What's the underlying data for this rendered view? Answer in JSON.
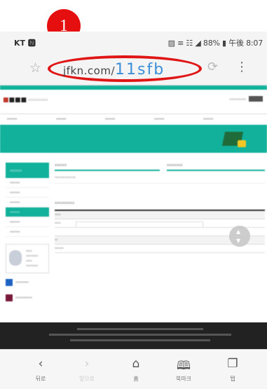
{
  "status": {
    "carrier": "KT 🅽",
    "right": "▨ ≡ ☷ ◢ 88% ▮ 午後 8:07"
  },
  "browser": {
    "url_domain": "jfkn.com/",
    "url_path": "11sfb",
    "annotation_number": "1"
  },
  "bottom_nav": {
    "back_label": "뒤로",
    "forward_label": "앞으로",
    "home_label": "홈",
    "bookmarks_label": "북마크",
    "tabs_label": "탭"
  },
  "icons": {
    "star": "star-icon",
    "reload": "reload-icon",
    "menu": "kebab-menu-icon",
    "back": "back-arrow-icon",
    "forward": "forward-arrow-icon",
    "home": "home-icon",
    "bookmarks": "bookmarks-icon",
    "tabs": "tabs-icon"
  },
  "colors": {
    "accent": "#12b19b",
    "annotation": "#e01515",
    "url_path": "#3b8fd8"
  }
}
